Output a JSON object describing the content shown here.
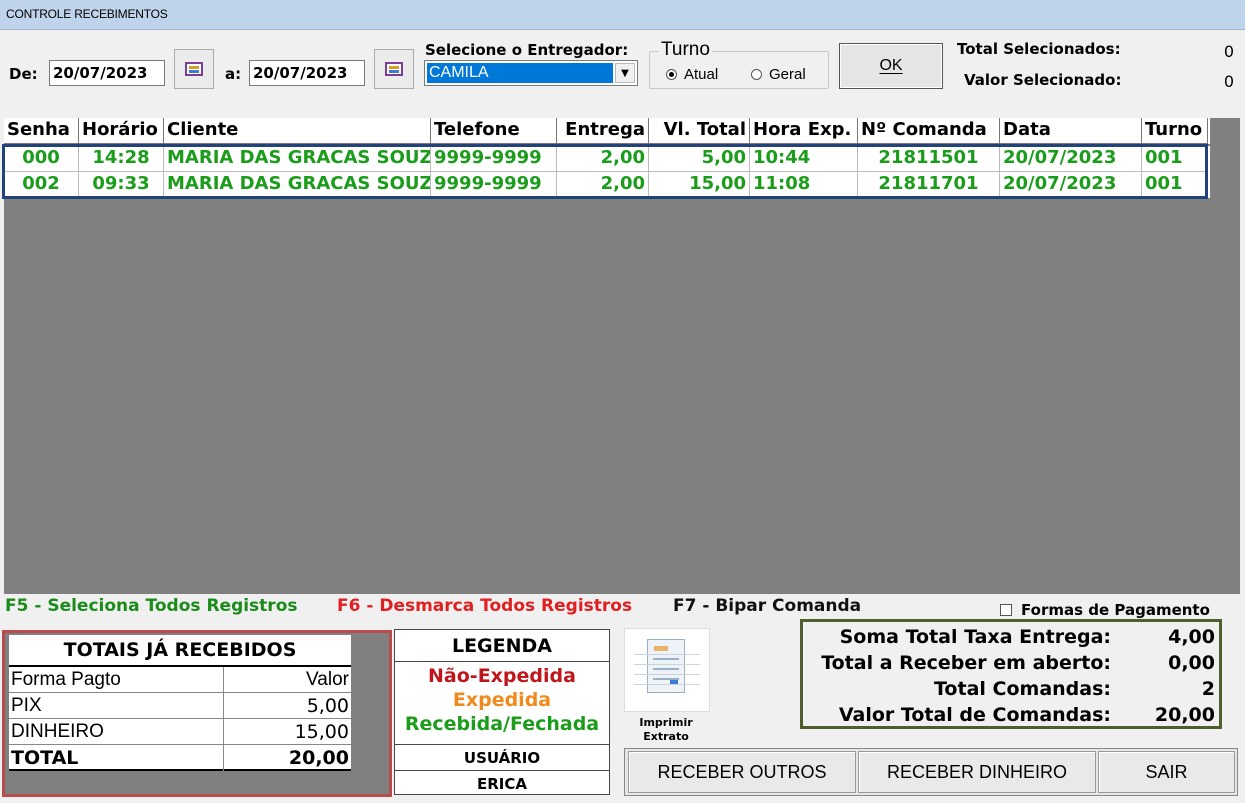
{
  "window": {
    "title": "CONTROLE RECEBIMENTOS"
  },
  "filters": {
    "from_label": "De:",
    "from_date": "20/07/2023",
    "to_label": "a:",
    "to_date": "20/07/2023",
    "courier_label": "Selecione o Entregador:",
    "courier_selected": "CAMILA",
    "shift_group_label": "Turno",
    "shift_options": [
      {
        "label": "Atual",
        "selected": true
      },
      {
        "label": "Geral",
        "selected": false
      }
    ],
    "ok_label": "OK"
  },
  "selection": {
    "total_label": "Total Selecionados:",
    "total_value": "0",
    "value_label": "Valor Selecionado:",
    "value_value": "0"
  },
  "table": {
    "columns": [
      "Senha",
      "Horário",
      "Cliente",
      "Telefone",
      "Entrega",
      "Vl. Total",
      "Hora Exp.",
      "Nº Comanda",
      "Data",
      "Turno"
    ],
    "rows": [
      [
        "000",
        "14:28",
        "MARIA DAS GRACAS SOUZA",
        "9999-9999",
        "2,00",
        "5,00",
        "10:44",
        "21811501",
        "20/07/2023",
        "001"
      ],
      [
        "002",
        "09:33",
        "MARIA DAS GRACAS SOUZA",
        "9999-9999",
        "2,00",
        "15,00",
        "11:08",
        "21811701",
        "20/07/2023",
        "001"
      ]
    ]
  },
  "shortcuts": {
    "f5": "F5 - Seleciona Todos Registros",
    "f6": "F6 - Desmarca Todos Registros",
    "f7": "F7 - Bipar Comanda",
    "payment_forms_label": "Formas de Pagamento"
  },
  "received_totals": {
    "title": "TOTAIS JÁ RECEBIDOS",
    "col_method": "Forma Pagto",
    "col_value": "Valor",
    "rows": [
      {
        "method": "PIX",
        "value": "5,00"
      },
      {
        "method": "DINHEIRO",
        "value": "15,00"
      }
    ],
    "total_label": "TOTAL",
    "total_value": "20,00"
  },
  "legend": {
    "title": "LEGENDA",
    "not_dispatched": "Não-Expedida",
    "dispatched": "Expedida",
    "received": "Recebida/Fechada",
    "user_label": "USUÁRIO",
    "user_name": "ERICA"
  },
  "print": {
    "label_line1": "Imprimir",
    "label_line2": "Extrato"
  },
  "summary": {
    "rows": [
      {
        "label": "Soma Total Taxa Entrega:",
        "value": "4,00"
      },
      {
        "label": "Total a Receber em aberto:",
        "value": "0,00"
      },
      {
        "label": "Total Comandas:",
        "value": "2"
      },
      {
        "label": "Valor Total de Comandas:",
        "value": "20,00"
      }
    ]
  },
  "actions": {
    "receive_others": "RECEBER OUTROS",
    "receive_cash": "RECEBER DINHEIRO",
    "exit": "SAIR"
  },
  "colors": {
    "title_bar": "#bfd3ea",
    "grid_background": "#808080",
    "row_text_received": "#1b9d1b",
    "not_dispatched": "#c0161b",
    "dispatched": "#f08a1c",
    "received": "#1b9d1b",
    "f5_color": "#1b8c1b",
    "f6_color": "#e02020",
    "selection_highlight": "#0078d7",
    "rows_frame": "#23427a",
    "totals_frame": "#b84c4c",
    "summary_frame": "#4e5e2c"
  }
}
